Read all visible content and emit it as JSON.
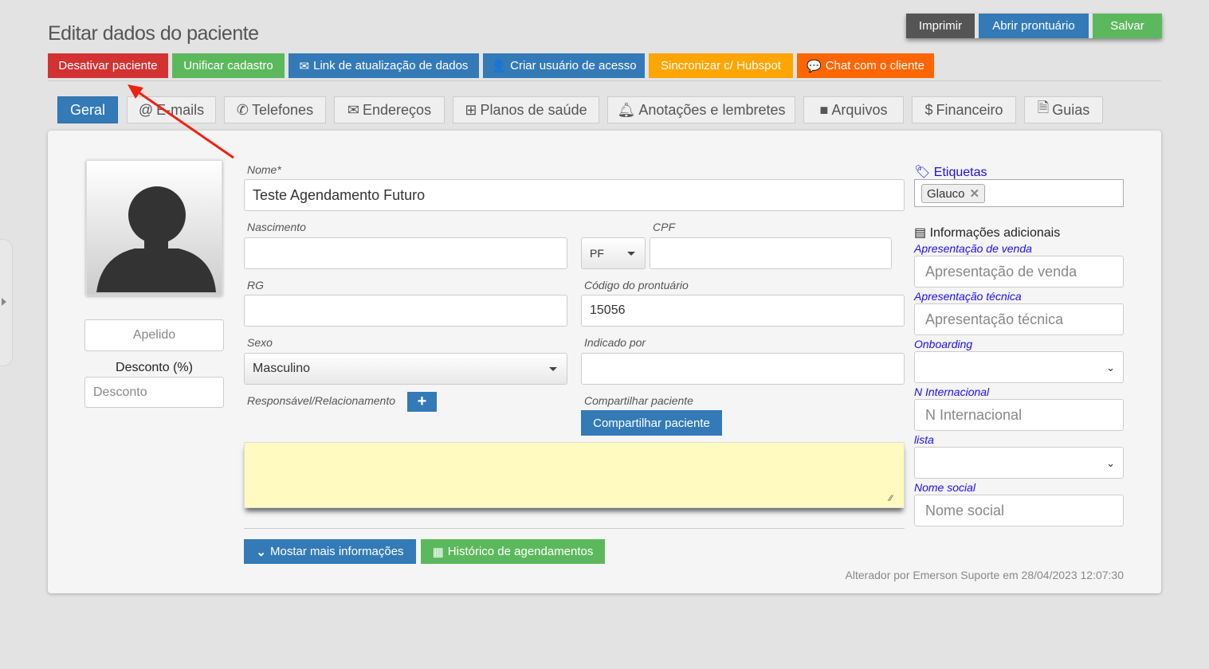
{
  "page": {
    "title": "Editar dados do paciente"
  },
  "top_actions": [
    {
      "label": "Imprimir",
      "color": "#555555"
    },
    {
      "label": "Abrir prontuário",
      "color": "#337ab7"
    },
    {
      "label": "Salvar",
      "color": "#5cb85c"
    }
  ],
  "actions": [
    {
      "label": "Desativar paciente",
      "color": "#d33232",
      "icon": ""
    },
    {
      "label": "Unificar cadastro",
      "color": "#5cb85c",
      "icon": ""
    },
    {
      "label": "Link de atualização de dados",
      "color": "#337ab7",
      "icon": "envelope-icon"
    },
    {
      "label": "Criar usuário de acesso",
      "color": "#337ab7",
      "icon": "user-plus-icon"
    },
    {
      "label": "Sincronizar c/ Hubspot",
      "color": "#ffa500",
      "icon": ""
    },
    {
      "label": "Chat com o cliente",
      "color": "#ff6600",
      "icon": "comments-icon"
    }
  ],
  "tabs": [
    {
      "label": "Geral",
      "icon": "",
      "active": true
    },
    {
      "label": "E-mails",
      "icon": "at-icon"
    },
    {
      "label": "Telefones",
      "icon": "phone-icon"
    },
    {
      "label": "Endereços",
      "icon": "envelope-icon"
    },
    {
      "label": "Planos de saúde",
      "icon": "medkit-icon"
    },
    {
      "label": "Anotações e lembretes",
      "icon": "bell-icon"
    },
    {
      "label": "Arquivos",
      "icon": "folder-icon"
    },
    {
      "label": "Financeiro",
      "icon": "dollar-icon"
    },
    {
      "label": "Guias",
      "icon": "file-text-icon"
    }
  ],
  "left": {
    "apelido_placeholder": "Apelido",
    "desconto_label": "Desconto (%)",
    "desconto_placeholder": "Desconto"
  },
  "form": {
    "nome_label": "Nome*",
    "nome_value": "Teste Agendamento Futuro",
    "nascimento_label": "Nascimento",
    "nascimento_value": "",
    "cpf_label": "CPF",
    "cpf_type": "PF",
    "cpf_value": "",
    "rg_label": "RG",
    "rg_value": "",
    "codigo_label": "Código do prontuário",
    "codigo_value": "15056",
    "sexo_label": "Sexo",
    "sexo_value": "Masculino",
    "indicado_label": "Indicado por",
    "indicado_value": "",
    "responsavel_label": "Responsável/Relacionamento",
    "compartilhar_label": "Compartilhar paciente",
    "compartilhar_button": "Compartilhar paciente",
    "notes_value": "",
    "notes_color": "#fffac0",
    "mostrar_button": "Mostar mais informações",
    "historico_button": "Histórico de agendamentos",
    "footer": "Alterador por Emerson Suporte em 28/04/2023 12:07:30"
  },
  "right": {
    "etiquetas_label": "Etiquetas",
    "tags": [
      "Glauco"
    ],
    "info_title": "Informações adicionais",
    "fields": [
      {
        "label": "Apresentação de venda",
        "type": "text",
        "placeholder": "Apresentação de venda"
      },
      {
        "label": "Apresentação técnica",
        "type": "text",
        "placeholder": "Apresentação técnica"
      },
      {
        "label": "Onboarding",
        "type": "select",
        "placeholder": ""
      },
      {
        "label": "N Internacional",
        "type": "text",
        "placeholder": "N Internacional"
      },
      {
        "label": "lista",
        "type": "select",
        "placeholder": ""
      },
      {
        "label": "Nome social",
        "type": "text",
        "placeholder": "Nome social"
      }
    ]
  }
}
